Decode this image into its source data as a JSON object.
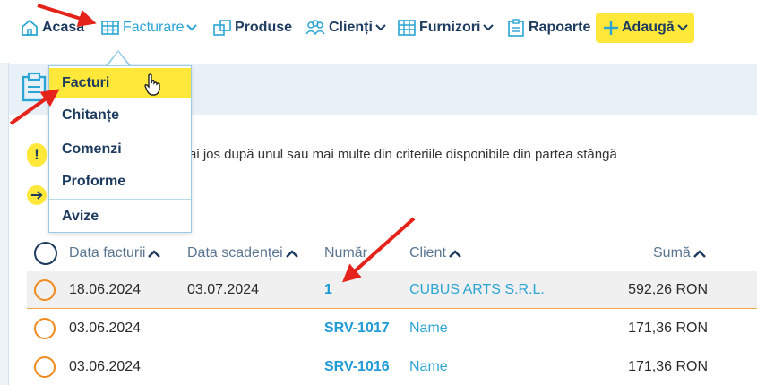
{
  "nav": {
    "home": "Acasă",
    "invoicing": "Facturare",
    "products": "Produse",
    "clients": "Clienți",
    "suppliers": "Furnizori",
    "reports": "Rapoarte",
    "add": "Adaugă"
  },
  "dropdown": {
    "items": [
      "Facturi",
      "Chitanțe",
      "Comenzi",
      "Proforme",
      "Avize"
    ]
  },
  "info": {
    "text": "ai jos după unul sau mai multe din criteriile disponibile din partea stângă"
  },
  "table": {
    "headers": {
      "date": "Data facturii",
      "due": "Data scadenței",
      "number": "Număr",
      "client": "Client",
      "amount": "Sumă"
    },
    "rows": [
      {
        "date": "18.06.2024",
        "due": "03.07.2024",
        "number": "1",
        "client": "CUBUS ARTS S.R.L.",
        "amount": "592,26 RON"
      },
      {
        "date": "03.06.2024",
        "due": "",
        "number": "SRV-1017",
        "client": "Name",
        "amount": "171,36 RON"
      },
      {
        "date": "03.06.2024",
        "due": "",
        "number": "SRV-1016",
        "client": "Name",
        "amount": "171,36 RON"
      }
    ]
  },
  "colors": {
    "accent_yellow": "#ffe83a",
    "link_blue": "#1f9ad6",
    "nav_text": "#1d3a5f",
    "row_border": "#f0a64a",
    "annotation_red": "#e5231b"
  }
}
